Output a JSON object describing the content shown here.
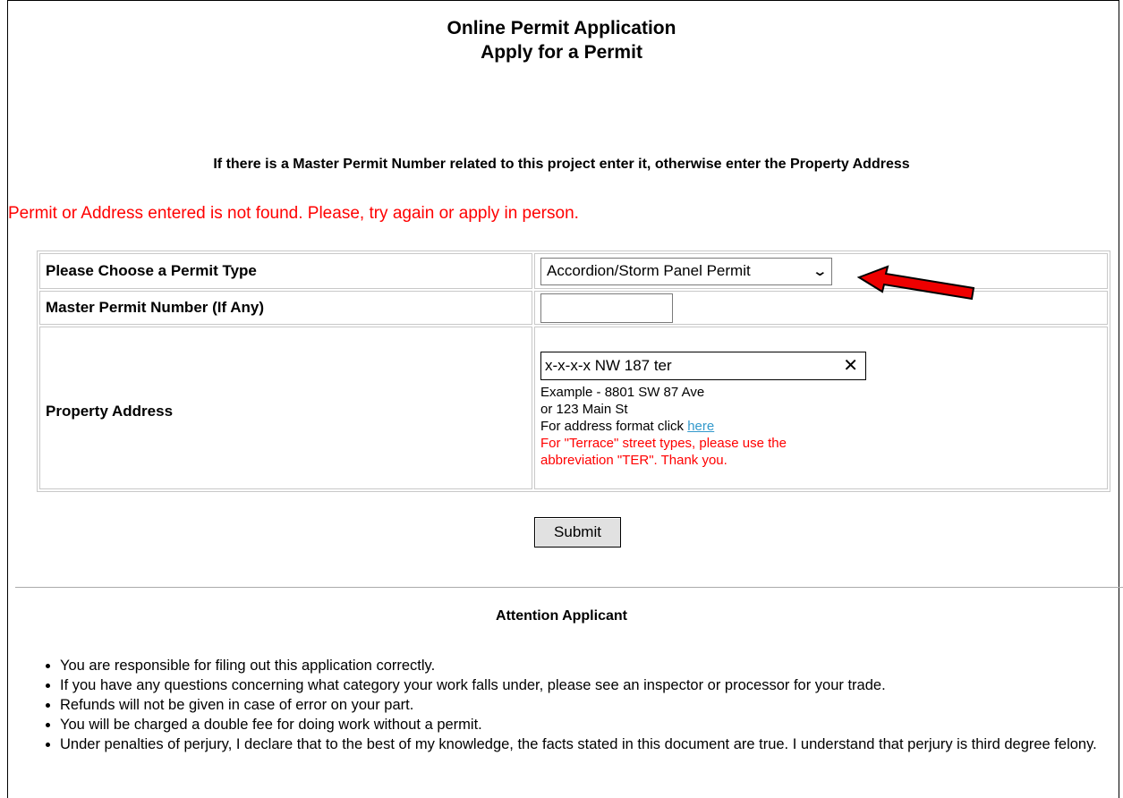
{
  "header": {
    "title": "Online Permit Application",
    "subtitle": "Apply for a Permit"
  },
  "instruction": "If there is a Master Permit Number related to this project enter it, otherwise enter the Property Address",
  "error_message": "Permit or Address entered is not found. Please, try again or apply in person.",
  "form": {
    "permit_type": {
      "label": "Please Choose a Permit Type",
      "selected_value": "Accordion/Storm Panel Permit"
    },
    "master_permit": {
      "label": "Master Permit Number (If Any)",
      "value": ""
    },
    "property_address": {
      "label": "Property Address",
      "value": "x-x-x-x  NW 187 ter",
      "example_line1": "Example - 8801 SW 87 Ave",
      "example_line2": "or 123 Main St",
      "format_text": "For address format click ",
      "format_link": "here",
      "terrace_note_line1": "For \"Terrace\" street types, please use the",
      "terrace_note_line2": "abbreviation \"TER\". Thank you."
    }
  },
  "submit_label": "Submit",
  "attention": {
    "heading": "Attention Applicant",
    "items": [
      "You are responsible for filing out this application correctly.",
      "If you have any questions concerning what category your work falls under, please see an inspector or processor for your trade.",
      "Refunds will not be given in case of error on your part.",
      "You will be charged a double fee for doing work without a permit.",
      "Under penalties of perjury, I declare that to the best of my knowledge, the facts stated in this document are true. I understand that perjury is third degree felony."
    ]
  },
  "colors": {
    "error": "#ff0000",
    "link": "#3399cc",
    "arrow": "#ee0000"
  }
}
